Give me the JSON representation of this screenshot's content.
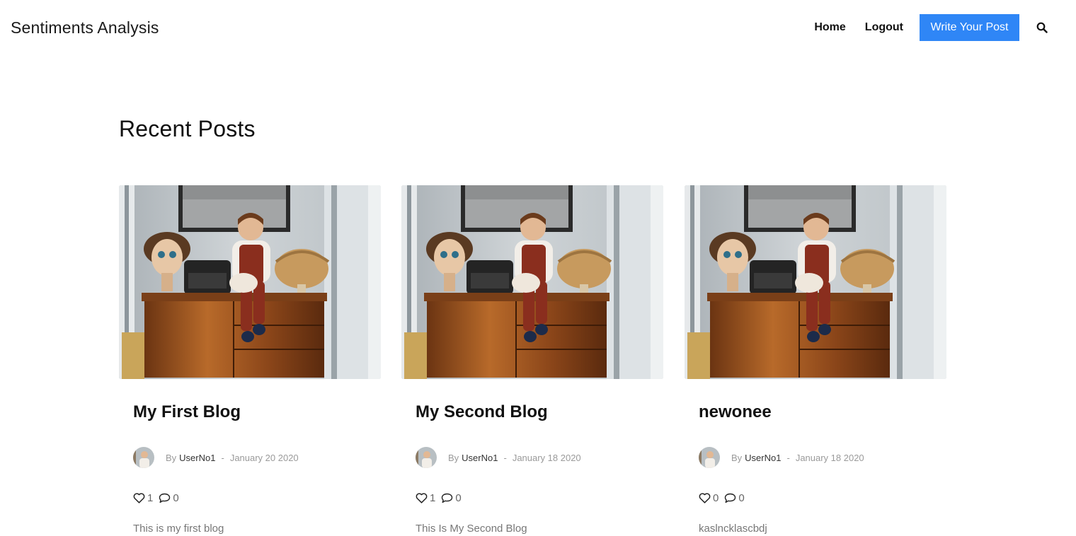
{
  "header": {
    "brand": "Sentiments Analysis",
    "nav": {
      "home": "Home",
      "logout": "Logout",
      "write": "Write Your Post"
    },
    "search_icon": "search-icon",
    "accent_color": "#2f86f6"
  },
  "main": {
    "title": "Recent Posts",
    "posts": [
      {
        "title": "My First Blog",
        "by": "By",
        "author": "UserNo1",
        "separator": "-",
        "date": "January 20 2020",
        "likes": "1",
        "comments": "0",
        "excerpt": "This is my first blog"
      },
      {
        "title": "My Second Blog",
        "by": "By",
        "author": "UserNo1",
        "separator": "-",
        "date": "January 18 2020",
        "likes": "1",
        "comments": "0",
        "excerpt": "This Is My Second Blog"
      },
      {
        "title": "newonee",
        "by": "By",
        "author": "UserNo1",
        "separator": "-",
        "date": "January 18 2020",
        "likes": "0",
        "comments": "0",
        "excerpt": "kaslncklascbdj"
      }
    ]
  },
  "icons": {
    "like": "heart-icon",
    "comment": "comment-icon"
  }
}
